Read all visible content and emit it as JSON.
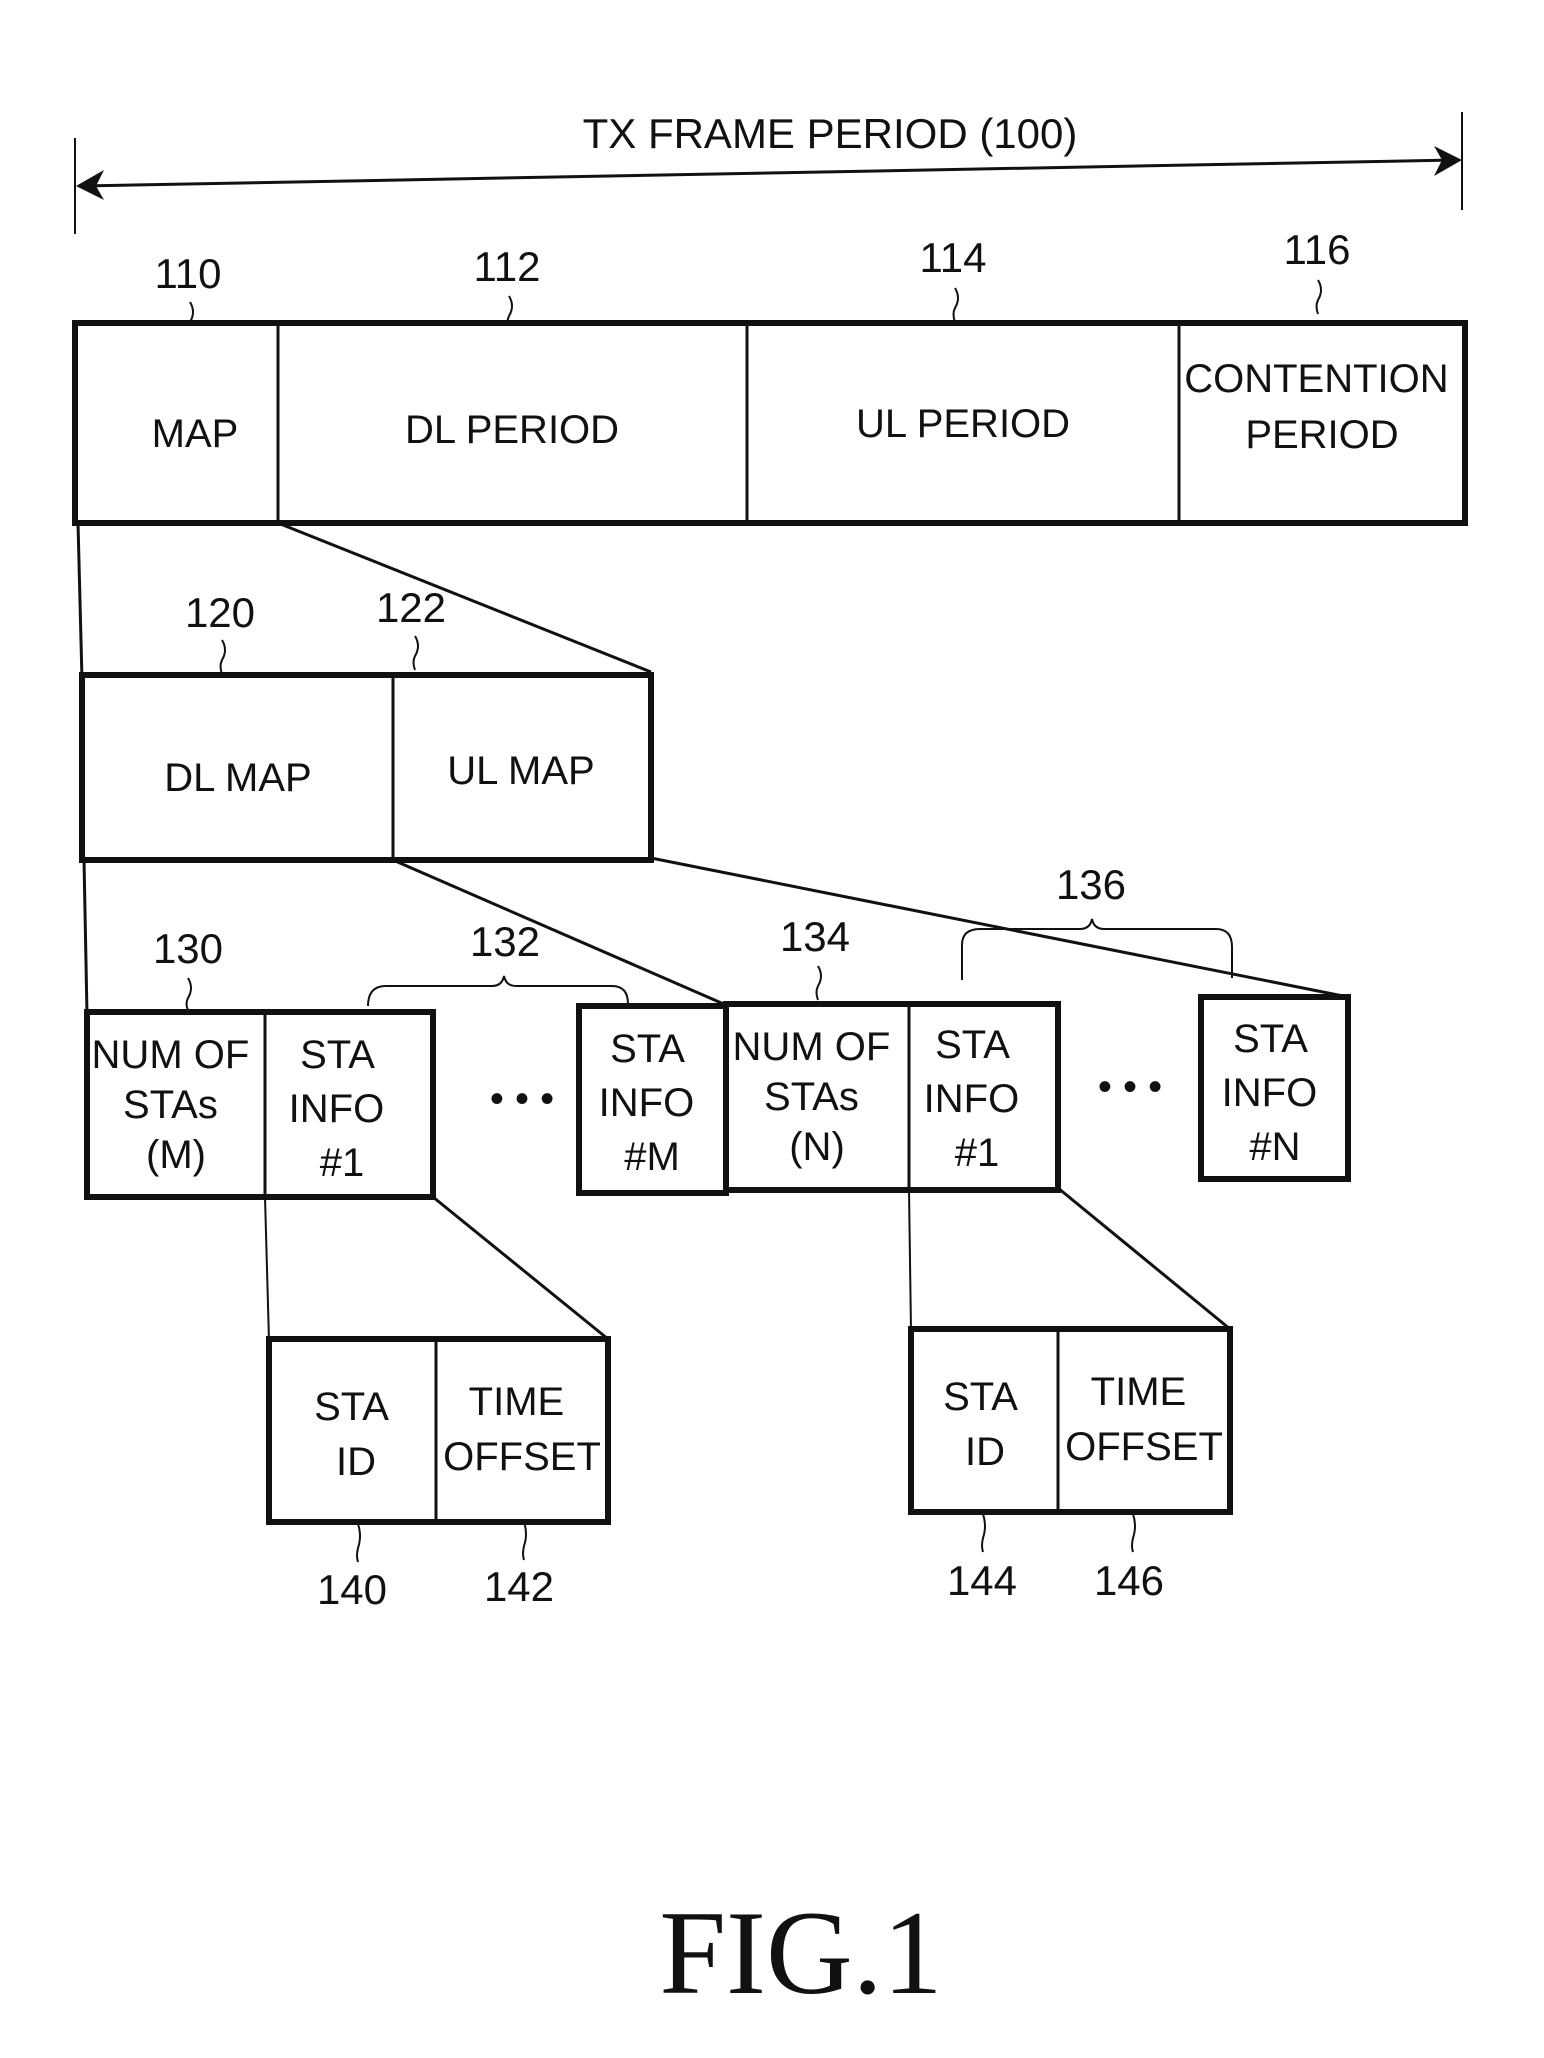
{
  "title": "TX FRAME PERIOD (100)",
  "figure_label": "FIG.1",
  "frame": {
    "ref_numbers": [
      "110",
      "112",
      "114",
      "116"
    ],
    "fields": [
      {
        "lines": [
          "MAP"
        ]
      },
      {
        "lines": [
          "DL PERIOD"
        ]
      },
      {
        "lines": [
          "UL PERIOD"
        ]
      },
      {
        "lines": [
          "CONTENTION",
          "PERIOD"
        ]
      }
    ]
  },
  "map": {
    "ref_numbers": [
      "120",
      "122"
    ],
    "fields": [
      {
        "lines": [
          "DL MAP"
        ]
      },
      {
        "lines": [
          "UL MAP"
        ]
      }
    ]
  },
  "dl_map": {
    "ref_numbers": [
      "130",
      "132"
    ],
    "fields": [
      {
        "lines": [
          "NUM OF",
          "STAs",
          "(M)"
        ]
      },
      {
        "lines": [
          "STA",
          "INFO",
          "#1"
        ]
      },
      {
        "lines": [
          "STA",
          "INFO",
          "#M"
        ]
      }
    ],
    "ellipsis": "• • •"
  },
  "ul_map": {
    "ref_numbers": [
      "134",
      "136"
    ],
    "fields": [
      {
        "lines": [
          "NUM OF",
          "STAs",
          "(N)"
        ]
      },
      {
        "lines": [
          "STA",
          "INFO",
          "#1"
        ]
      },
      {
        "lines": [
          "STA",
          "INFO",
          "#N"
        ]
      }
    ],
    "ellipsis": "• • •"
  },
  "dl_sta_info": {
    "ref_numbers": [
      "140",
      "142"
    ],
    "fields": [
      {
        "lines": [
          "STA",
          "ID"
        ]
      },
      {
        "lines": [
          "TIME",
          "OFFSET"
        ]
      }
    ]
  },
  "ul_sta_info": {
    "ref_numbers": [
      "144",
      "146"
    ],
    "fields": [
      {
        "lines": [
          "STA",
          "ID"
        ]
      },
      {
        "lines": [
          "TIME",
          "OFFSET"
        ]
      }
    ]
  }
}
